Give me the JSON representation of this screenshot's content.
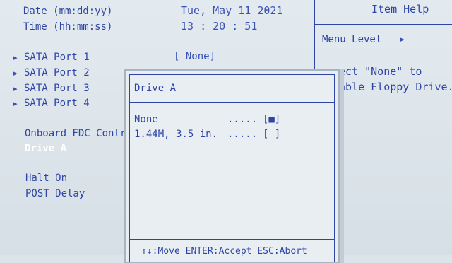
{
  "date_row": {
    "label": "Date (mm:dd:yy)",
    "value": "Tue, May 11 2021"
  },
  "time_row": {
    "label": "Time (hh:mm:ss)",
    "value": "13 : 20 : 51"
  },
  "sata_ports": [
    {
      "label": "SATA Port 1",
      "value": "[ None]"
    },
    {
      "label": "SATA Port 2"
    },
    {
      "label": "SATA Port 3"
    },
    {
      "label": "SATA Port 4"
    }
  ],
  "onboard_fdc": {
    "label": "Onboard FDC Contr"
  },
  "drive_a": {
    "label": "Drive A"
  },
  "halt_on": {
    "label": "Halt On"
  },
  "post_delay": {
    "label": "POST Delay"
  },
  "help": {
    "title": "Item Help",
    "menu_level": "Menu Level",
    "text_line1": "ect \"None\" to",
    "text_line2": "able Floppy Drive."
  },
  "popup": {
    "title": "Drive A",
    "options": [
      {
        "label": "None",
        "dots": ".....",
        "mark": "[■]"
      },
      {
        "label": "1.44M, 3.5 in.",
        "dots": ".....",
        "mark": "[ ]"
      }
    ],
    "footer": "↑↓:Move ENTER:Accept ESC:Abort"
  }
}
